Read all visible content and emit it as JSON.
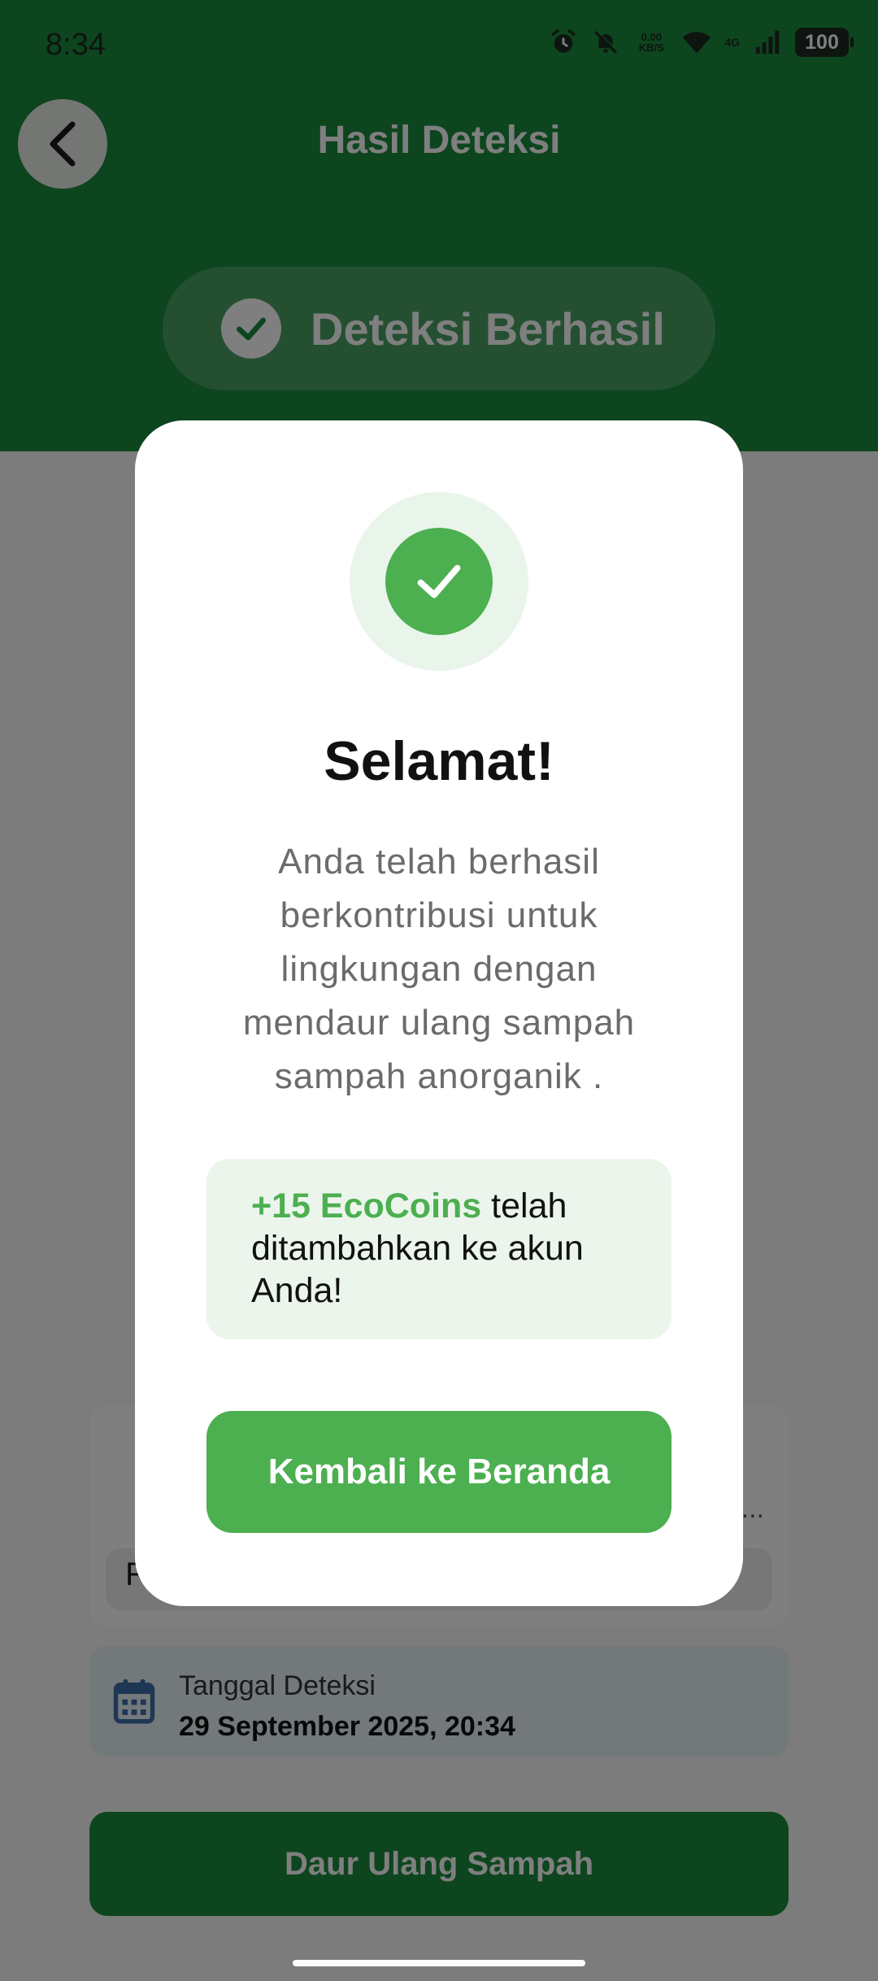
{
  "status_bar": {
    "time": "8:34",
    "net_speed_value": "0.00",
    "net_speed_unit": "KB/S",
    "network_type": "4G",
    "battery": "100"
  },
  "header": {
    "title": "Hasil Deteksi",
    "badge_text": "Deteksi Berhasil"
  },
  "detection_card": {
    "partial_text": "R",
    "overflow_text": "..."
  },
  "date_card": {
    "label": "Tanggal Deteksi",
    "value": "29 September 2025, 20:34"
  },
  "primary_action": {
    "label": "Daur Ulang Sampah"
  },
  "dialog": {
    "title": "Selamat!",
    "message": "Anda telah berhasil berkontribusi untuk lingkungan dengan mendaur ulang sampah sampah anorganik .",
    "reward_amount": "+15 EcoCoins",
    "reward_suffix": " telah ditambahkan ke akun Anda!",
    "button_label": "Kembali ke Beranda"
  },
  "colors": {
    "primary_green": "#1b8a3c",
    "accent_green": "#4caf50",
    "light_green": "#ebf5ec",
    "date_card_bg": "#e6f0f7",
    "calendar_icon": "#3a6fa8",
    "scrim": "rgba(0,0,0,0.5)"
  },
  "icons": {
    "back": "arrow-left-icon",
    "badge": "check-circle-icon",
    "date": "calendar-icon",
    "dialog": "check-icon",
    "status": [
      "alarm-icon",
      "bell-off-icon",
      "wifi-icon",
      "signal-icon",
      "battery-icon"
    ]
  }
}
